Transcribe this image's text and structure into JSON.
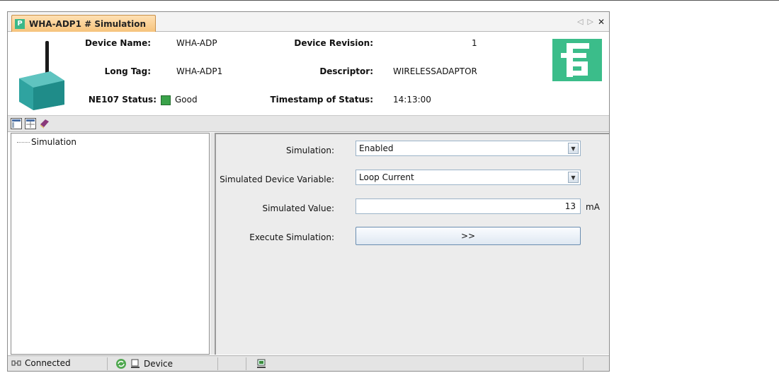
{
  "tab": {
    "title": "WHA-ADP1 # Simulation",
    "logo_text": "P",
    "controls": {
      "prev": "◁",
      "next": "▷",
      "close": "✕"
    }
  },
  "header": {
    "device_name_label": "Device Name:",
    "device_name_value": "WHA-ADP",
    "long_tag_label": "Long Tag:",
    "long_tag_value": "WHA-ADP1",
    "ne107_label": "NE107 Status:",
    "ne107_value": "Good",
    "device_revision_label": "Device Revision:",
    "device_revision_value": "1",
    "descriptor_label": "Descriptor:",
    "descriptor_value": "WIRELESSADAPTOR",
    "timestamp_label": "Timestamp of Status:",
    "timestamp_value": "14:13:00",
    "status_color": "#3aa24a",
    "brand_color": "#3bbd8a"
  },
  "toolbar": {
    "icons": [
      "layout-icon",
      "window-icon",
      "book-icon"
    ]
  },
  "tree": {
    "items": [
      {
        "label": "Simulation"
      }
    ]
  },
  "form": {
    "simulation_label": "Simulation:",
    "simulation_value": "Enabled",
    "variable_label": "Simulated Device Variable:",
    "variable_value": "Loop Current",
    "value_label": "Simulated Value:",
    "value_value": "13",
    "value_unit": "mA",
    "execute_label": "Execute Simulation:",
    "execute_button": ">>"
  },
  "statusbar": {
    "connected": "Connected",
    "device": "Device"
  }
}
